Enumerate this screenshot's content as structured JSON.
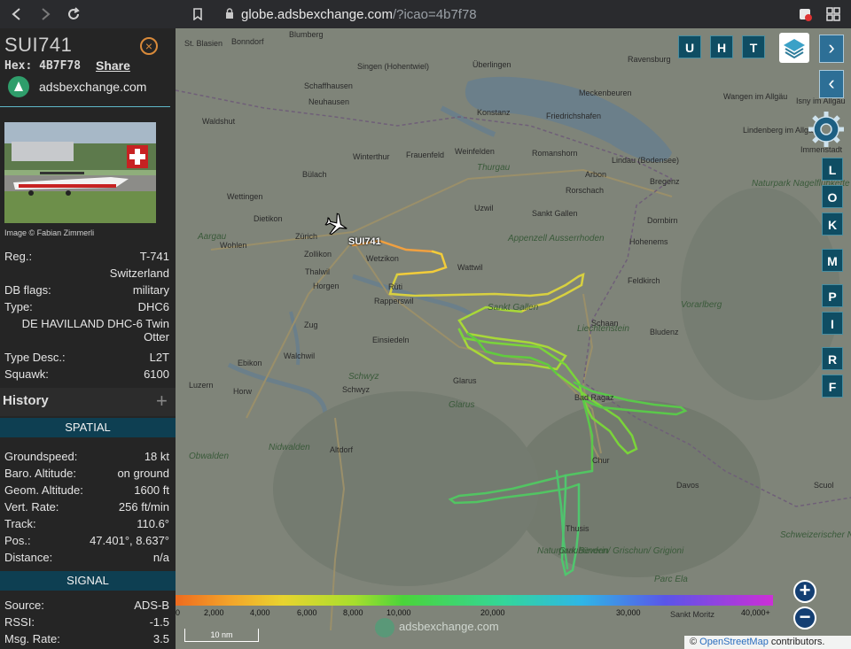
{
  "browser": {
    "url_domain": "globe.adsbexchange.com",
    "url_path": "/?icao=4b7f78"
  },
  "aircraft": {
    "callsign": "SUI741",
    "hex_label": "Hex:",
    "hex": "4B7F78",
    "share": "Share",
    "site": "adsbexchange.com",
    "photo_credit": "Image © Fabian Zimmerli"
  },
  "info": {
    "reg_key": "Reg.:",
    "reg_val": "T-741",
    "country": "Switzerland",
    "db_key": "DB flags:",
    "db_val": "military",
    "type_key": "Type:",
    "type_val": "DHC6",
    "type_full": "DE HAVILLAND DHC-6 Twin Otter",
    "desc_key": "Type Desc.:",
    "desc_val": "L2T",
    "squawk_key": "Squawk:",
    "squawk_val": "6100"
  },
  "history": {
    "title": "History"
  },
  "spatial": {
    "title": "SPATIAL",
    "rows": [
      {
        "k": "Groundspeed:",
        "v": "18 kt"
      },
      {
        "k": "Baro. Altitude:",
        "v": "on ground"
      },
      {
        "k": "Geom. Altitude:",
        "v": "1600 ft"
      },
      {
        "k": "Vert. Rate:",
        "v": "256 ft/min"
      },
      {
        "k": "Track:",
        "v": "110.6°"
      },
      {
        "k": "Pos.:",
        "v": "47.401°, 8.637°"
      },
      {
        "k": "Distance:",
        "v": "n/a"
      }
    ]
  },
  "signal": {
    "title": "SIGNAL",
    "rows": [
      {
        "k": "Source:",
        "v": "ADS-B"
      },
      {
        "k": "RSSI:",
        "v": "-1.5"
      },
      {
        "k": "Msg. Rate:",
        "v": "3.5"
      }
    ]
  },
  "map": {
    "plane_label": "SUI741",
    "top_buttons": [
      "U",
      "H",
      "T"
    ],
    "side_buttons": [
      "L",
      "O",
      "K",
      "M",
      "P",
      "I",
      "R",
      "F"
    ],
    "altitude_scale": [
      "0",
      "2,000",
      "4,000",
      "6,000",
      "8,000",
      "10,000",
      "20,000",
      "30,000",
      "40,000+"
    ],
    "distance": "10 nm",
    "watermark": "adsbexchange.com",
    "attribution_prefix": "© ",
    "attribution_link": "OpenStreetMap",
    "attribution_suffix": " contributors.",
    "towns": [
      {
        "n": "Blumberg"
      },
      {
        "n": "Bonndorf"
      },
      {
        "n": "St. Blasien"
      },
      {
        "n": "Singen (Hohentwiel)"
      },
      {
        "n": "Überlingen"
      },
      {
        "n": "Ravensburg"
      },
      {
        "n": "Schaffhausen"
      },
      {
        "n": "Neuhausen"
      },
      {
        "n": "Konstanz"
      },
      {
        "n": "Meckenbeuren"
      },
      {
        "n": "Friedrichshafen"
      },
      {
        "n": "Waldshut"
      },
      {
        "n": "Frauenfeld"
      },
      {
        "n": "Weinfelden"
      },
      {
        "n": "Romanshorn"
      },
      {
        "n": "Lindau (Bodensee)"
      },
      {
        "n": "Bülach"
      },
      {
        "n": "Winterthur"
      },
      {
        "n": "Arbon"
      },
      {
        "n": "Rorschach"
      },
      {
        "n": "Bregenz"
      },
      {
        "n": "Wettingen"
      },
      {
        "n": "Uzwil"
      },
      {
        "n": "Sankt Gallen"
      },
      {
        "n": "Dornbirn"
      },
      {
        "n": "Dietikon"
      },
      {
        "n": "Zürich"
      },
      {
        "n": "Wohlen"
      },
      {
        "n": "Zollikon"
      },
      {
        "n": "Wetzikon"
      },
      {
        "n": "Wattwil"
      },
      {
        "n": "Hohenems"
      },
      {
        "n": "Thalwil"
      },
      {
        "n": "Horgen"
      },
      {
        "n": "Rüti"
      },
      {
        "n": "Rapperswil"
      },
      {
        "n": "Feldkirch"
      },
      {
        "n": "Bludenz"
      },
      {
        "n": "Schaan"
      },
      {
        "n": "Glarus"
      },
      {
        "n": "Ebikon"
      },
      {
        "n": "Luzern"
      },
      {
        "n": "Horw"
      },
      {
        "n": "Schwyz"
      },
      {
        "n": "Altdorf"
      },
      {
        "n": "Bad Ragaz"
      },
      {
        "n": "Chur"
      },
      {
        "n": "Davos"
      },
      {
        "n": "Thusis"
      },
      {
        "n": "Scuol"
      },
      {
        "n": "Sankt Moritz"
      },
      {
        "n": "Wangen im Allgäu"
      },
      {
        "n": "Isny im Allgäu"
      },
      {
        "n": "Lindenberg im Allgäu"
      },
      {
        "n": "Immenstadt"
      },
      {
        "n": "Einsiedeln"
      },
      {
        "n": "Walchwil"
      },
      {
        "n": "Zug"
      }
    ],
    "regions": [
      {
        "n": "Aargau"
      },
      {
        "n": "Thurgau"
      },
      {
        "n": "Appenzell Ausserrhoden"
      },
      {
        "n": "Liechtenstein"
      },
      {
        "n": "Vorarlberg"
      },
      {
        "n": "Sankt Gallen"
      },
      {
        "n": "Glarus"
      },
      {
        "n": "Nidwalden"
      },
      {
        "n": "Obwalden"
      },
      {
        "n": "Schwyz"
      },
      {
        "n": "Graubünden/ Grischun/ Grigioni"
      },
      {
        "n": "Parc Ela"
      },
      {
        "n": "Naturpark Beverin"
      },
      {
        "n": "Naturpark Nagelfluhkette"
      },
      {
        "n": "Schweizerischer Nationalpark"
      }
    ]
  }
}
